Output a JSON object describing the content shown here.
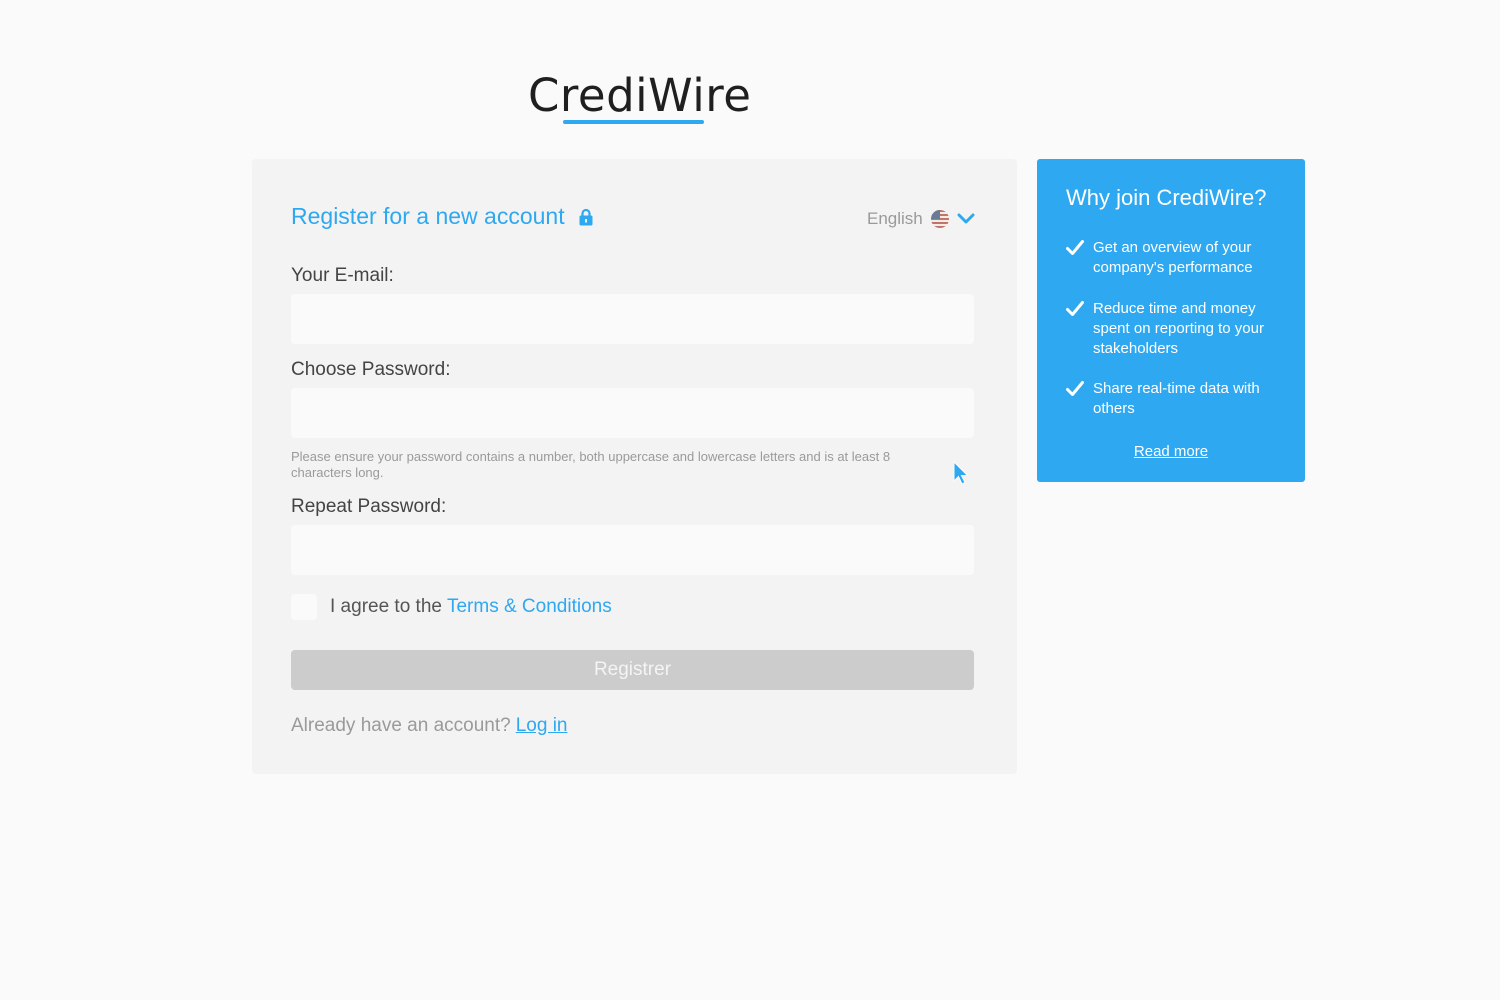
{
  "logo": {
    "text": "CrediWire"
  },
  "form": {
    "title": "Register for a new account",
    "language": {
      "label": "English",
      "flag_icon": "us-flag-icon"
    },
    "email": {
      "label": "Your E-mail:",
      "value": "",
      "placeholder": ""
    },
    "password": {
      "label": "Choose Password:",
      "value": "",
      "placeholder": "",
      "hint": "Please ensure your password contains a number, both uppercase and lowercase letters and is at least 8 characters long."
    },
    "repeat_password": {
      "label": "Repeat Password:",
      "value": "",
      "placeholder": ""
    },
    "agree": {
      "text": "I agree to the",
      "link": "Terms & Conditions",
      "checked": false
    },
    "register_button": "Registrer",
    "login": {
      "prompt": "Already have an account?",
      "link": "Log in"
    }
  },
  "info": {
    "title": "Why join CrediWire?",
    "benefits": [
      "Get an overview of your company's performance",
      "Reduce time and money spent on reporting to your stakeholders",
      "Share real-time data with others"
    ],
    "read_more": "Read more"
  },
  "colors": {
    "accent": "#2ea8f1",
    "card_background": "#f3f3f3",
    "page_background": "#fafafa",
    "disabled_button": "#cccccc"
  }
}
